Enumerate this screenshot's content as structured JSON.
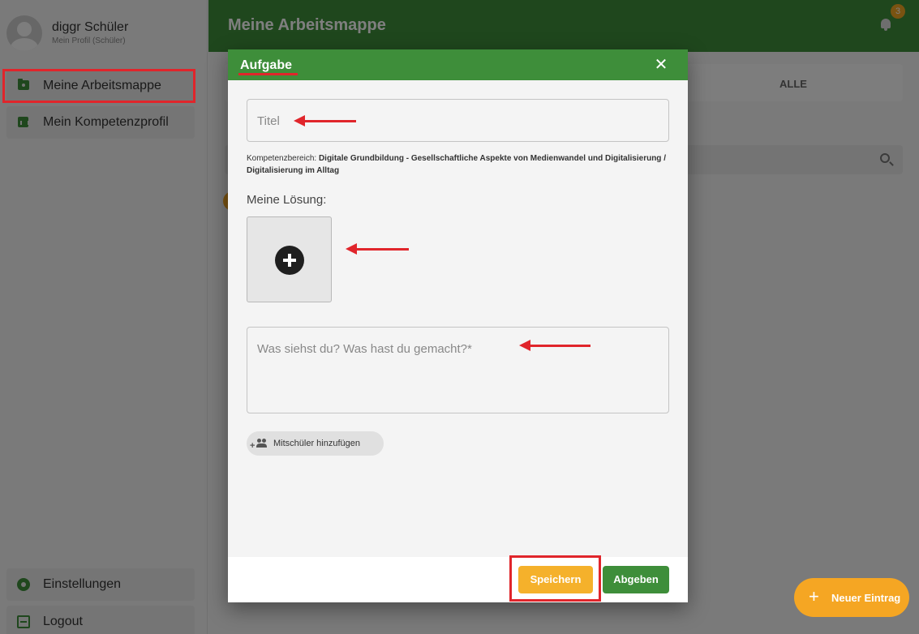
{
  "profile": {
    "name": "diggr Schüler",
    "subtitle": "Mein Profil (Schüler)"
  },
  "sidebar": {
    "items": [
      {
        "label": "Meine Arbeitsmappe",
        "icon": "folder-user-icon"
      },
      {
        "label": "Mein Kompetenzprofil",
        "icon": "bar-chart-icon"
      }
    ],
    "bottom_items": [
      {
        "label": "Einstellungen",
        "icon": "gear-icon"
      },
      {
        "label": "Logout",
        "icon": "logout-icon"
      }
    ]
  },
  "appbar": {
    "title": "Meine Arbeitsmappe",
    "notification_count": "3"
  },
  "main": {
    "tab_all": "ALLE",
    "fab_plus": "+",
    "fab_label": "Neuer Eintrag"
  },
  "dialog": {
    "title": "Aufgabe",
    "close": "✕",
    "title_placeholder": "Titel",
    "kompetenz_prefix": "Kompetenzbereich: ",
    "kompetenz_value": "Digitale Grundbildung - Gesellschaftliche Aspekte von Medienwandel und Digitalisierung / Digitalisierung im Alltag",
    "solution_label": "Meine Lösung:",
    "description_placeholder": "Was siehst du? Was hast du gemacht?*",
    "add_classmates": "Mitschüler hinzufügen",
    "add_classmates_plus": "+",
    "save_button": "Speichern",
    "submit_button": "Abgeben"
  },
  "colors": {
    "primary_green": "#3e8e3a",
    "accent_orange": "#f5a623",
    "annotation_red": "#e0252b"
  }
}
